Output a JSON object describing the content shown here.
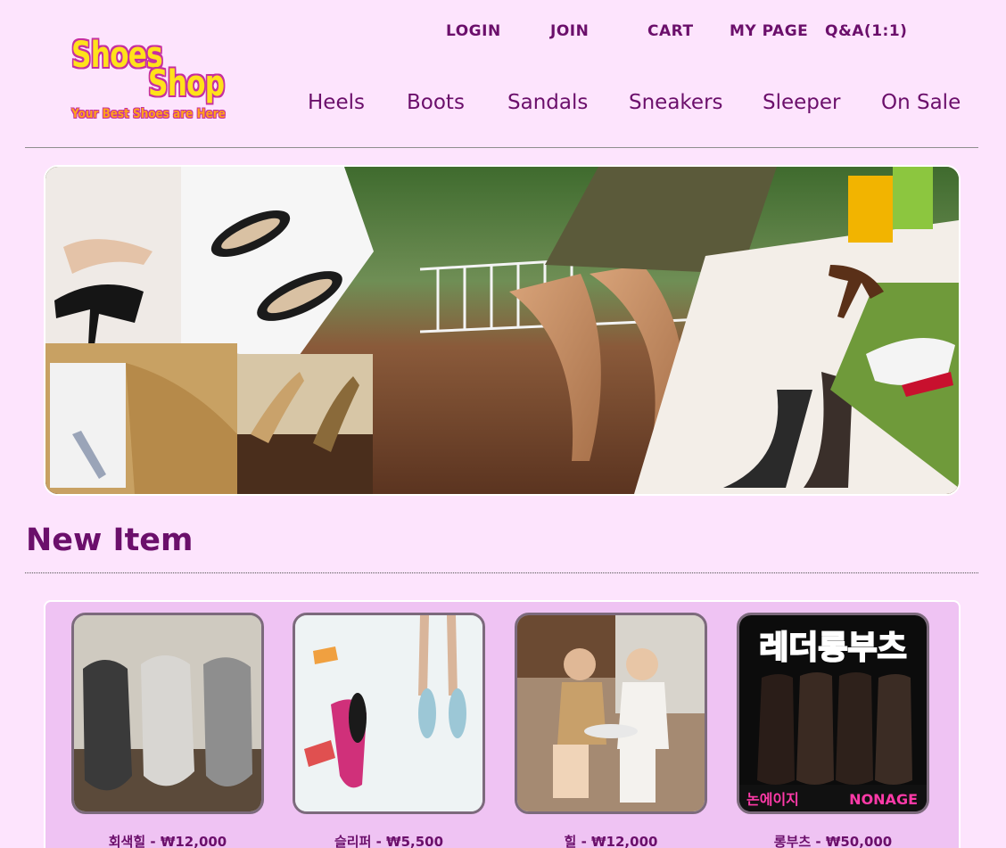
{
  "logo": {
    "word1": "Shoes",
    "word2": "Shop",
    "tagline": "Your Best Shoes are Here"
  },
  "top_nav": [
    "LOGIN",
    "JOIN",
    "CART",
    "MY PAGE",
    "Q&A(1:1)"
  ],
  "category_nav": [
    "Heels",
    "Boots",
    "Sandals",
    "Sneakers",
    "Sleeper",
    "On Sale"
  ],
  "banner": {
    "icon": "shoes-collage-image"
  },
  "new_item": {
    "title": "New Item",
    "products": [
      {
        "caption": "회색힐 - ₩12,000",
        "icon": "heels-photo"
      },
      {
        "caption": "슬리퍼 - ₩5,500",
        "icon": "slippers-photo"
      },
      {
        "caption": "힐 - ₩12,000",
        "icon": "women-cafe-photo"
      },
      {
        "caption": "롱부츠 - ₩50,000",
        "icon": "long-boots-photo",
        "overlay_top": "레더롱부츠",
        "overlay_bottom_left": "논에이지",
        "overlay_bottom_right": "NONAGE"
      }
    ]
  },
  "colors": {
    "background": "#fde4fd",
    "text": "#6b0f6b",
    "product_panel": "#efc3f3",
    "logo_yellow": "#ffe21a",
    "logo_outline": "#c62fa0"
  }
}
